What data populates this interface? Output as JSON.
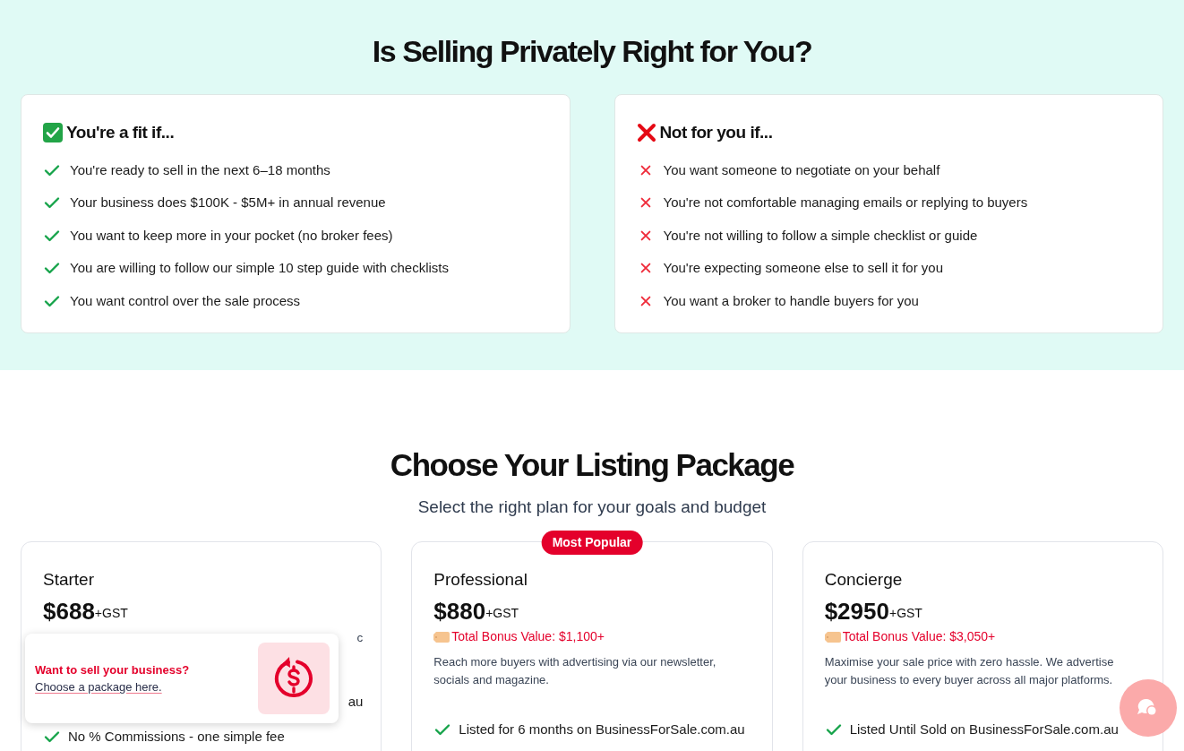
{
  "fit_section": {
    "title": "Is Selling Privately Right for You?",
    "cards": [
      {
        "kind": "yes",
        "heading": "You're a fit if...",
        "items": [
          "You're ready to sell in the next 6–18 months",
          "Your business does $100K - $5M+ in annual revenue",
          "You want to keep more in your pocket (no broker fees)",
          "You are willing to follow our simple 10 step guide with checklists",
          "You want control over the sale process"
        ]
      },
      {
        "kind": "no",
        "heading": "Not for you if...",
        "items": [
          "You want someone to negotiate on your behalf",
          "You're not comfortable managing emails or replying to buyers",
          "You're not willing to follow a simple checklist or guide",
          "You're expecting someone else to sell it for you",
          "You want a broker to handle buyers for you"
        ]
      }
    ]
  },
  "packages": {
    "title": "Choose Your Listing Package",
    "subtitle": "Select the right plan for your goals and budget",
    "plans": [
      {
        "name": "Starter",
        "price": "$688",
        "tax": "+GST",
        "description_fragment": "c",
        "features": [
          {
            "kind": "fragment",
            "text": "au"
          },
          {
            "kind": "full",
            "text": "No % Commissions - one simple fee"
          }
        ]
      },
      {
        "name": "Professional",
        "badge": "Most Popular",
        "price": "$880",
        "tax": "+GST",
        "bonus": "Total Bonus Value: $1,100+",
        "description": "Reach more buyers with advertising via our newsletter, socials and magazine.",
        "features": [
          {
            "kind": "full",
            "text": "Listed for 6 months on BusinessForSale.com.au"
          }
        ]
      },
      {
        "name": "Concierge",
        "price": "$2950",
        "tax": "+GST",
        "bonus": "Total Bonus Value: $3,050+",
        "description": "Maximise your sale price with zero hassle. We advertise your business to every buyer across all major platforms.",
        "features": [
          {
            "kind": "full",
            "text": "Listed Until Sold on BusinessForSale.com.au"
          }
        ]
      }
    ]
  },
  "popup": {
    "title": "Want to sell your business?",
    "link": "Choose a package here."
  }
}
